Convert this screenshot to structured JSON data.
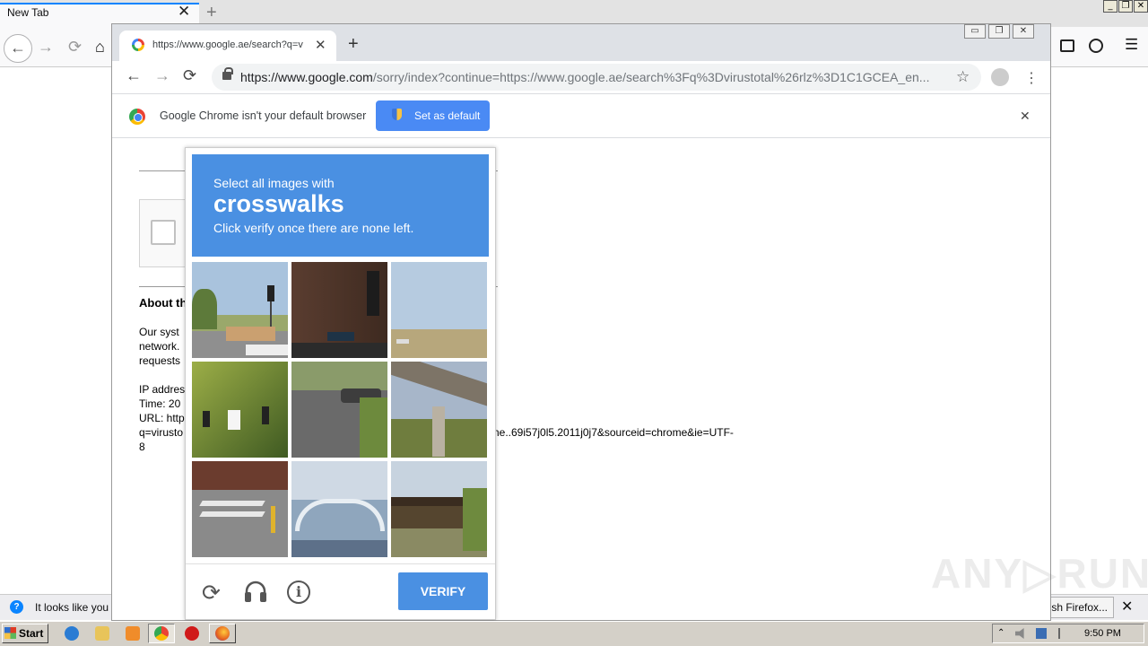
{
  "firefox": {
    "tab_title": "New Tab",
    "tab_close": "✕",
    "new_tab": "+",
    "window_buttons": [
      "_",
      "❐",
      "✕"
    ],
    "nav": {
      "back": "←",
      "forward": "→",
      "reload": "⟳",
      "home": "⌂"
    },
    "menu_glyph": "☰",
    "notification": {
      "text": "It looks like you h",
      "button_label": "esh Firefox...",
      "close": "✕"
    }
  },
  "chrome": {
    "tab_title": "https://www.google.ae/search?q=v",
    "tab_close": "✕",
    "new_tab": "+",
    "window_buttons": [
      "▭",
      "❐",
      "✕"
    ],
    "nav": {
      "back": "←",
      "forward": "→",
      "reload": "⟳"
    },
    "url_host": "https://www.google.com",
    "url_rest": "/sorry/index?continue=https://www.google.ae/search%3Fq%3Dvirustotal%26rlz%3D1C1GCEA_en...",
    "star": "☆",
    "menu": "⋮",
    "infobar": {
      "text": "Google Chrome isn't your default browser",
      "button_label": "Set as default",
      "close": "✕"
    }
  },
  "page": {
    "about_heading": "About th",
    "lines": [
      "Our syst",
      "network.",
      "requests",
      "IP addres",
      "Time: 20",
      "URL: http",
      "q=virusto",
      "8"
    ],
    "url_tail": "ome..69i57j0l5.2011j0j7&sourceid=chrome&ie=UTF-"
  },
  "captcha": {
    "instruction_top": "Select all images with",
    "target": "crosswalks",
    "instruction_bottom": "Click verify once there are none left.",
    "tiles": [
      "street-with-traffic-light",
      "building-with-traffic-signal",
      "open-field-road",
      "trees-with-traffic-lights",
      "residential-street",
      "highway-overpass",
      "crosswalk-corner",
      "arched-bridge",
      "rail-bridge"
    ],
    "reload_icon": "⟳",
    "info_icon": "i",
    "verify_label": "VERIFY"
  },
  "watermark": "ANY▷RUN",
  "taskbar": {
    "start_label": "Start",
    "clock": "9:50 PM"
  },
  "colors": {
    "captcha_blue": "#4a90e2",
    "chrome_button_blue": "#4a8af4",
    "firefox_blue": "#0a84ff"
  }
}
